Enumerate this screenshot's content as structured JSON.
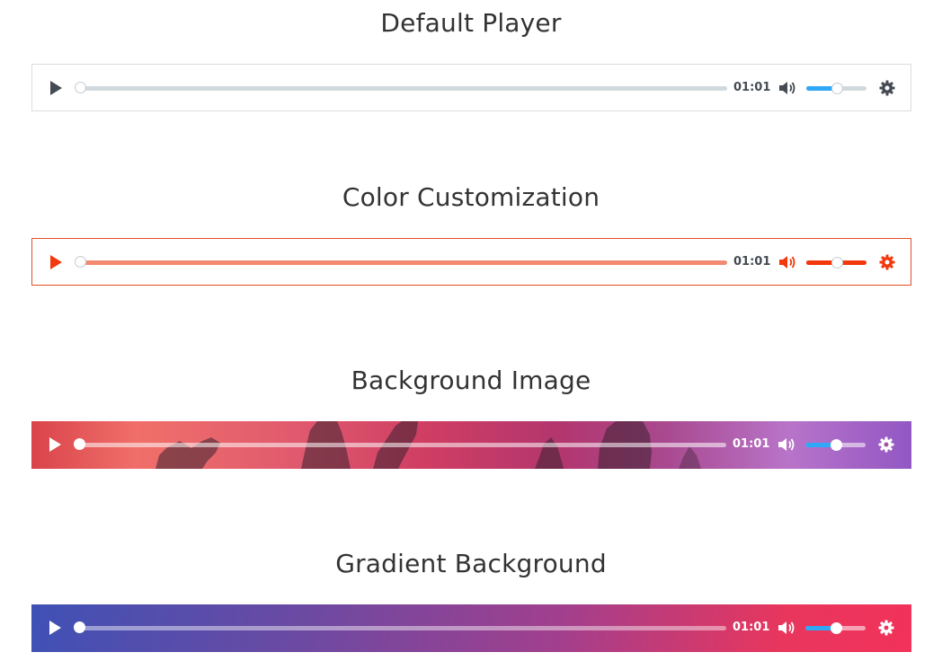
{
  "sections": [
    {
      "title": "Default Player",
      "time": "01:01",
      "volume_fraction": 0.5,
      "progress_fraction": 0
    },
    {
      "title": "Color Customization",
      "time": "01:01",
      "volume_fraction": 0.5,
      "progress_fraction": 0
    },
    {
      "title": "Background Image",
      "time": "01:01",
      "volume_fraction": 0.5,
      "progress_fraction": 0
    },
    {
      "title": "Gradient Background",
      "time": "01:01",
      "volume_fraction": 0.5,
      "progress_fraction": 0
    }
  ],
  "colors": {
    "default_icon": "#444b52",
    "default_track": "#d2d9de",
    "volume_accent": "#2fa8f5",
    "custom_accent": "#f2380c",
    "custom_track": "#f28a72",
    "light_icon": "#ffffff"
  },
  "icons": {
    "play": "play-icon",
    "volume": "volume-icon",
    "settings": "gear-icon"
  }
}
